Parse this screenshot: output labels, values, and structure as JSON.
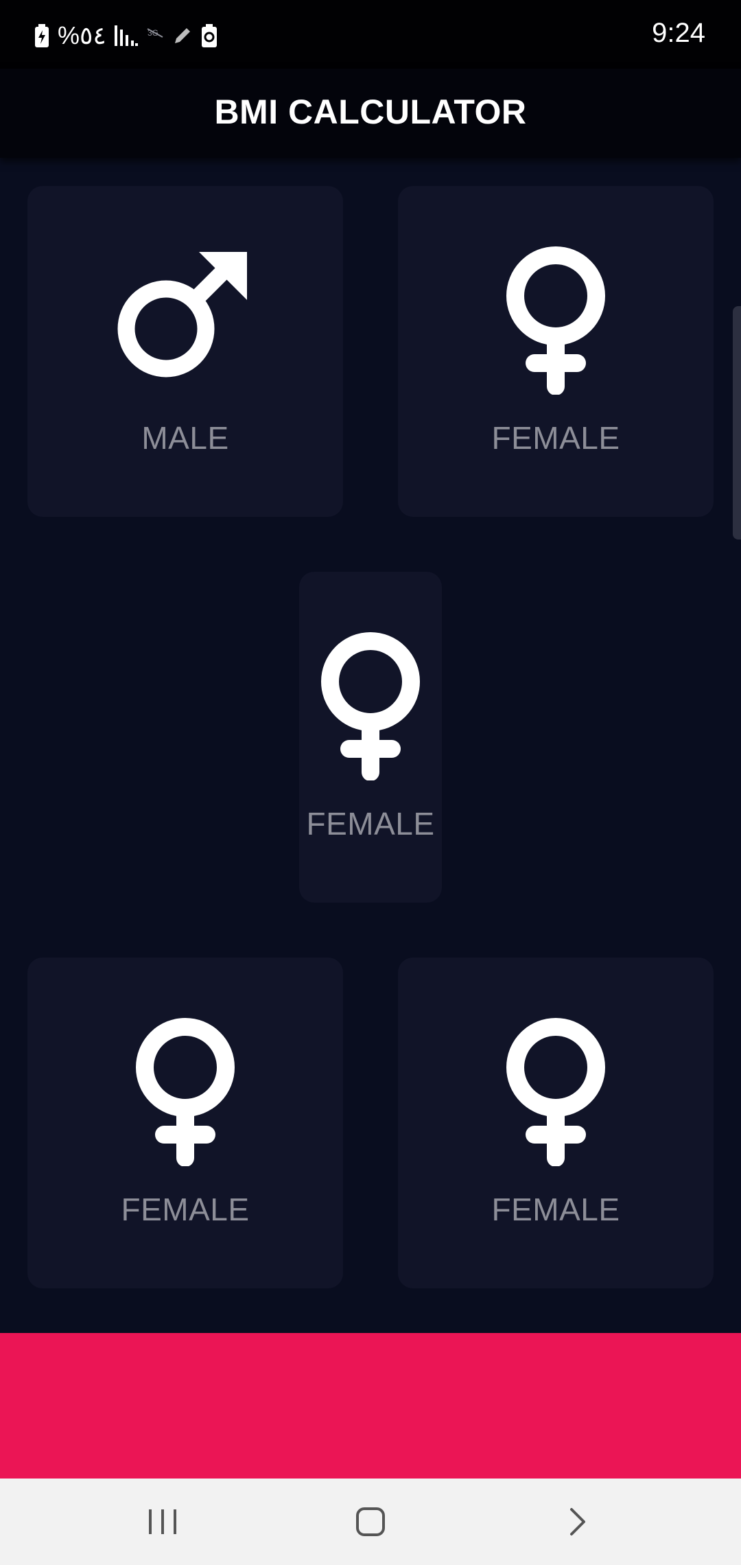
{
  "status_bar": {
    "battery_percent": "%٥٤",
    "time": "9:24",
    "icons": [
      "battery-charging-icon",
      "signal-icon",
      "no-network-icon",
      "edit-icon",
      "battery-saver-icon"
    ]
  },
  "app_bar": {
    "title": "BMI CALCULATOR"
  },
  "cards": [
    {
      "label": "MALE",
      "icon": "male-icon"
    },
    {
      "label": "FEMALE",
      "icon": "female-icon"
    },
    {
      "label": "FEMALE",
      "icon": "female-icon"
    },
    {
      "label": "FEMALE",
      "icon": "female-icon"
    },
    {
      "label": "FEMALE",
      "icon": "female-icon"
    }
  ],
  "bottom_button": {
    "color": "#eb1555"
  },
  "nav_bar": {
    "items": [
      "recent-apps-icon",
      "home-icon",
      "back-icon"
    ]
  },
  "colors": {
    "background": "#090d1f",
    "card": "#111428",
    "label": "#8d8e98",
    "accent": "#eb1555"
  }
}
